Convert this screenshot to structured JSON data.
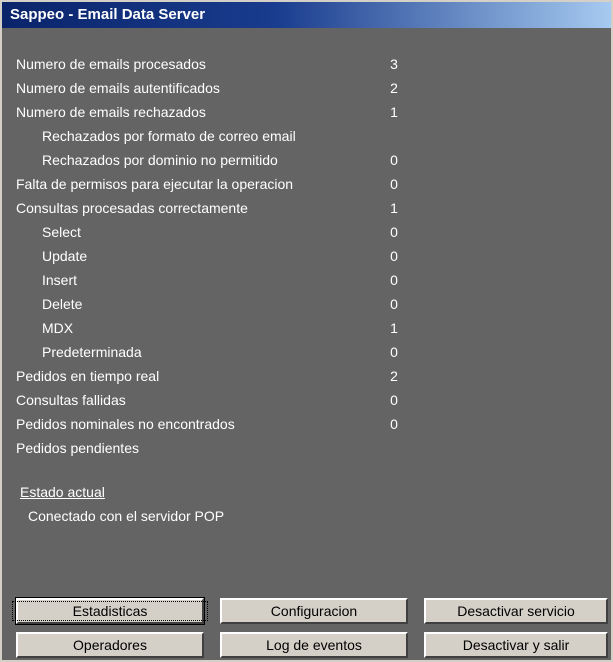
{
  "window": {
    "title": "Sappeo - Email Data Server"
  },
  "stats": [
    {
      "label": "Numero de emails procesados",
      "value": "3",
      "indent": false
    },
    {
      "label": "Numero de emails autentificados",
      "value": "2",
      "indent": false
    },
    {
      "label": "Numero de emails rechazados",
      "value": "1",
      "indent": false
    },
    {
      "label": "Rechazados por formato de correo email",
      "value": "",
      "indent": true
    },
    {
      "label": "Rechazados por dominio no permitido",
      "value": "0",
      "indent": true
    },
    {
      "label": "Falta de permisos para ejecutar la operacion",
      "value": "0",
      "indent": false
    },
    {
      "label": "Consultas procesadas correctamente",
      "value": "1",
      "indent": false
    },
    {
      "label": "Select",
      "value": "0",
      "indent": true
    },
    {
      "label": "Update",
      "value": "0",
      "indent": true
    },
    {
      "label": "Insert",
      "value": "0",
      "indent": true
    },
    {
      "label": "Delete",
      "value": "0",
      "indent": true
    },
    {
      "label": "MDX",
      "value": "1",
      "indent": true
    },
    {
      "label": "Predeterminada",
      "value": "0",
      "indent": true
    },
    {
      "label": "Pedidos en tiempo real",
      "value": "2",
      "indent": false
    },
    {
      "label": "Consultas fallidas",
      "value": "0",
      "indent": false
    },
    {
      "label": "Pedidos nominales no encontrados",
      "value": "0",
      "indent": false
    },
    {
      "label": "Pedidos pendientes",
      "value": "",
      "indent": false
    }
  ],
  "status": {
    "heading": "Estado actual",
    "text": "Conectado con el servidor POP"
  },
  "buttons": {
    "stats": "Estadisticas",
    "config": "Configuracion",
    "deactivate_service": "Desactivar servicio",
    "operators": "Operadores",
    "log": "Log de eventos",
    "deactivate_exit": "Desactivar y salir"
  }
}
